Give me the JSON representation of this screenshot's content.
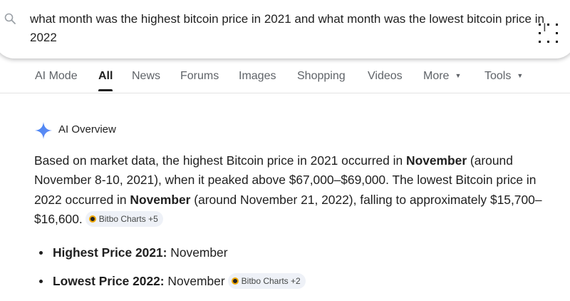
{
  "search": {
    "query": "what month was the highest bitcoin price in 2021 and what month was the lowest bitcoin price in 2022"
  },
  "tabs": [
    {
      "label": "AI Mode"
    },
    {
      "label": "All",
      "active": true
    },
    {
      "label": "News"
    },
    {
      "label": "Forums"
    },
    {
      "label": "Images"
    },
    {
      "label": "Shopping"
    },
    {
      "label": "Videos"
    },
    {
      "label": "More"
    },
    {
      "label": "Tools"
    }
  ],
  "ai_overview": {
    "label": "AI Overview",
    "p1": "Based on market data, the highest Bitcoin price in 2021 occurred in ",
    "b1": "November",
    "p2": " (around November 8-10, 2021), when it peaked above $67,000–$69,000. The lowest Bitcoin price in 2022 occurred in ",
    "b2": "November",
    "p3": " (around November 21, 2022), falling to approximately $15,700–$16,600.",
    "chip1": "Bitbo Charts +5",
    "bullets": [
      {
        "label": "Highest Price 2021:",
        "value": " November"
      },
      {
        "label": "Lowest Price 2022:",
        "value": " November",
        "chip": "Bitbo Charts +2"
      }
    ]
  },
  "colors": {
    "accent_blue": "#4285f4",
    "text": "#1f1f1f",
    "muted": "#5f6368",
    "chip_bg": "#eef1f7"
  },
  "icons": [
    "search-icon",
    "sparkle-icon",
    "chevron-down-icon",
    "favicon-icon"
  ]
}
